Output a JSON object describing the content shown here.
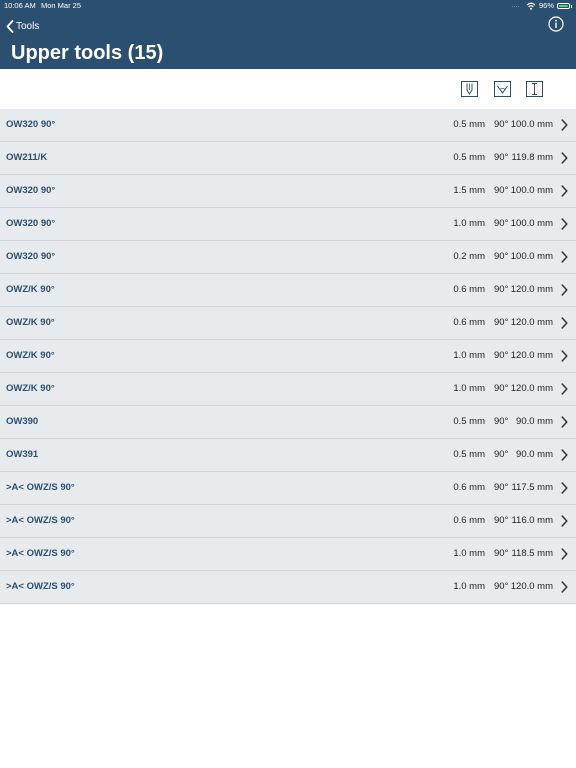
{
  "status_bar": {
    "time": "10:06 AM",
    "date": "Mon Mar 25",
    "signal_dots": "....",
    "battery_percent": "96%",
    "battery_level": 0.96,
    "icons": [
      "wifi-icon",
      "battery-icon"
    ]
  },
  "nav": {
    "back_label": "Tools",
    "back_icon": "chevron-left-icon",
    "info_icon": "info-icon",
    "title": "Upper tools (15)"
  },
  "columns": {
    "icons": [
      "tool-height-icon",
      "tool-angle-icon",
      "tool-length-icon"
    ]
  },
  "colors": {
    "header_bg": "#2b4f70",
    "row_bg": "#e8ebee",
    "row_border": "#d2d6db",
    "tool_name": "#2b4f70",
    "battery_fill": "#4cd964"
  },
  "tools": [
    {
      "name": "OW320 90°",
      "thickness": "0.5 mm",
      "angle": "90°",
      "height": "100.0 mm"
    },
    {
      "name": "OW211/K",
      "thickness": "0.5 mm",
      "angle": "90°",
      "height": "119.8 mm"
    },
    {
      "name": "OW320 90°",
      "thickness": "1.5 mm",
      "angle": "90°",
      "height": "100.0 mm"
    },
    {
      "name": "OW320 90°",
      "thickness": "1.0 mm",
      "angle": "90°",
      "height": "100.0 mm"
    },
    {
      "name": "OW320 90°",
      "thickness": "0.2 mm",
      "angle": "90°",
      "height": "100.0 mm"
    },
    {
      "name": "OWZ/K 90°",
      "thickness": "0.6 mm",
      "angle": "90°",
      "height": "120.0 mm"
    },
    {
      "name": "OWZ/K 90°",
      "thickness": "0.6 mm",
      "angle": "90°",
      "height": "120.0 mm"
    },
    {
      "name": "OWZ/K 90°",
      "thickness": "1.0 mm",
      "angle": "90°",
      "height": "120.0 mm"
    },
    {
      "name": "OWZ/K 90°",
      "thickness": "1.0 mm",
      "angle": "90°",
      "height": "120.0 mm"
    },
    {
      "name": "OW390",
      "thickness": "0.5 mm",
      "angle": "90°",
      "height": "90.0 mm"
    },
    {
      "name": "OW391",
      "thickness": "0.5 mm",
      "angle": "90°",
      "height": "90.0 mm"
    },
    {
      "name": ">A< OWZ/S 90°",
      "thickness": "0.6 mm",
      "angle": "90°",
      "height": "117.5 mm"
    },
    {
      "name": ">A< OWZ/S 90°",
      "thickness": "0.6 mm",
      "angle": "90°",
      "height": "116.0 mm"
    },
    {
      "name": ">A< OWZ/S 90°",
      "thickness": "1.0 mm",
      "angle": "90°",
      "height": "118.5 mm"
    },
    {
      "name": ">A< OWZ/S 90°",
      "thickness": "1.0 mm",
      "angle": "90°",
      "height": "120.0 mm"
    }
  ]
}
